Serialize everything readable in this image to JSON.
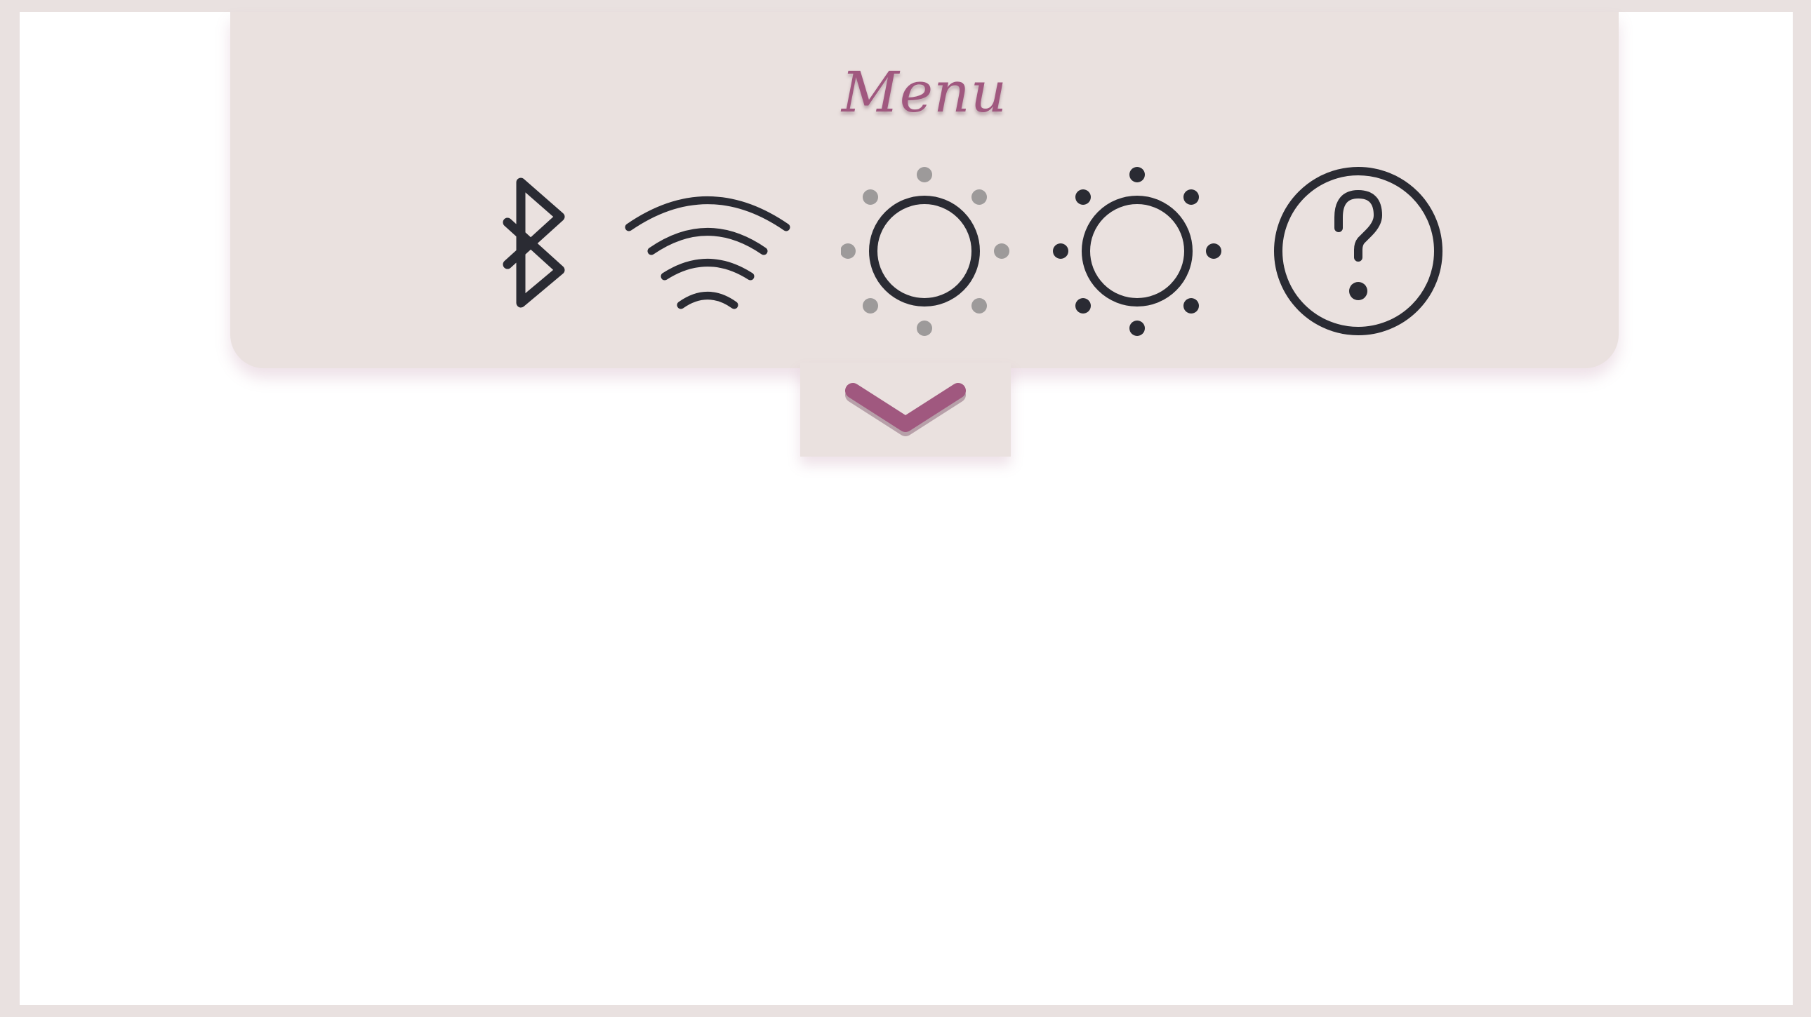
{
  "menu": {
    "title": "Menu",
    "items": [
      {
        "icon": "bluetooth-icon"
      },
      {
        "icon": "wifi-icon"
      },
      {
        "icon": "brightness-low-icon"
      },
      {
        "icon": "brightness-high-icon"
      },
      {
        "icon": "help-icon"
      }
    ],
    "toggle_icon": "chevron-down-icon"
  },
  "colors": {
    "background": "#ffffff",
    "frame": "#e9e1e0",
    "panel": "#eae1df",
    "accent": "#a0587f",
    "icon_stroke": "#2a2b33",
    "icon_dim": "#9d9a9a"
  }
}
